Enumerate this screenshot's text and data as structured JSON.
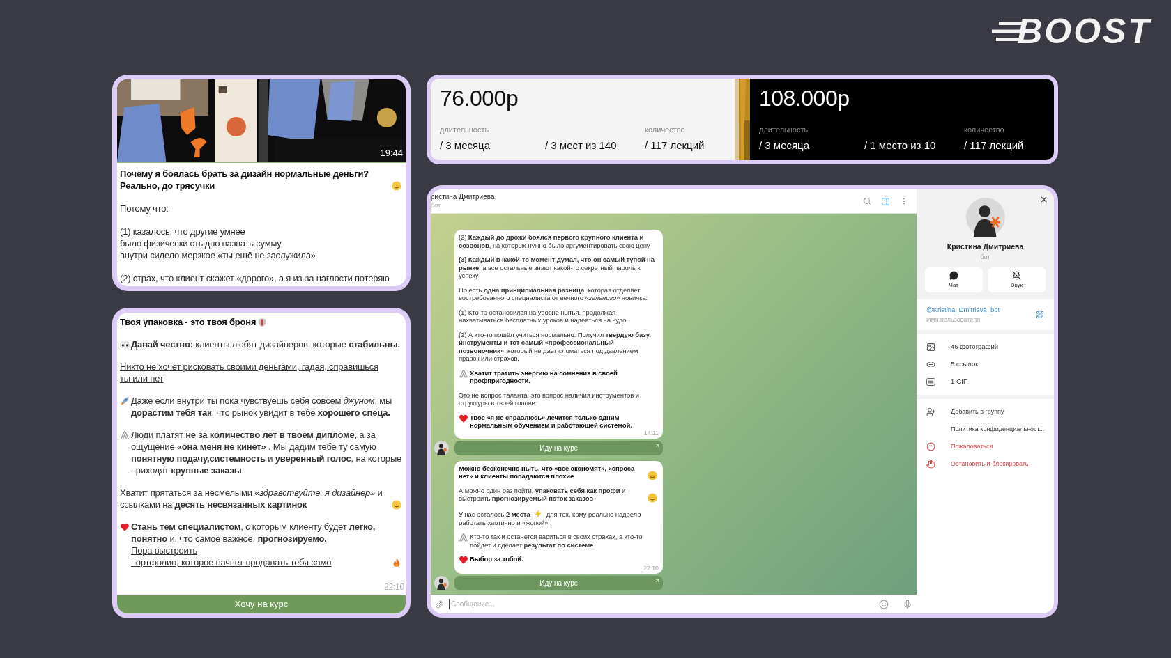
{
  "logo": {
    "text": "BOOST"
  },
  "post_preview": {
    "timestamp": "19:44",
    "paragraphs": [
      [
        {
          "kind": "text",
          "bold": true,
          "text": "Почему я боялась брать за дизайн нормальные деньги? Реально, до трясучки"
        },
        {
          "kind": "smile"
        }
      ],
      [
        {
          "kind": "text",
          "bold": false,
          "text": "Потому что:"
        }
      ],
      [
        {
          "kind": "text",
          "bold": false,
          "text": "(1) казалось, что другие умнее\nбыло физически стыдно назвать сумму\nвнутри сидело мерзкое «ты ещё не заслужила»"
        }
      ],
      [
        {
          "kind": "text",
          "bold": false,
          "text": "(2) страх, что клиент скажет «дорого», а я из-за наглости потеряю"
        }
      ]
    ]
  },
  "post_full": {
    "timestamp": "22:10",
    "button": "Хочу на курс",
    "paragraphs": [
      [
        {
          "kind": "text",
          "bold": true,
          "text": "Твоя упаковка - это твоя броня"
        },
        {
          "kind": "shield"
        }
      ],
      [
        {
          "kind": "eyes"
        },
        {
          "kind": "text",
          "bold": false,
          "text": "**Давай честно:** клиенты любят дизайнеров, которые **стабильны.**"
        }
      ],
      [
        {
          "kind": "link",
          "text": "Никто не хочет рисковать своими деньгами, гадая, справишься"
        },
        {
          "kind": "link",
          "text": "ты или нет"
        }
      ],
      [
        {
          "kind": "rocket"
        },
        {
          "kind": "text",
          "bold": false,
          "text": "Даже если внутри ты пока чувствуешь себя совсем *джуном*, мы **дорастим тебя так**, что рынок увидит в тебе **хорошего спеца.**"
        }
      ],
      [
        {
          "kind": "clip"
        },
        {
          "kind": "text",
          "bold": false,
          "text": "Люди платят **не за количество лет в твоем дипломе**, а за ощущение **«она меня не кинет»** . Мы дадим тебе ту самую **понятную подачу,системность** и **уверенный голос**, на которые приходят **крупные заказы**"
        }
      ],
      [
        {
          "kind": "text",
          "bold": false,
          "text": "Хватит прятаться за несмелыми *«здравствуйте, я дизайнер»* и ссылками на **десять несвязанных картинок**"
        },
        {
          "kind": "smile"
        }
      ],
      [
        {
          "kind": "heart"
        },
        {
          "kind": "text",
          "bold": false,
          "text": "**Стань тем специалистом**, с которым клиенту будет **легко, понятно** и, что самое важное, **прогнозируемо.**"
        },
        {
          "kind": "link",
          "text": "Пора выстроить"
        },
        {
          "kind": "link",
          "text": "портфолио, которое начнет продавать тебя само"
        },
        {
          "kind": "fire"
        }
      ]
    ]
  },
  "prices": [
    {
      "kind": "light",
      "price": "76.000р",
      "items": [
        {
          "label": "длительность",
          "value": "/ 3 месяца"
        },
        {
          "value": "/ 3 мест из 140"
        },
        {
          "label": "количество",
          "value": "/ 117 лекций"
        }
      ]
    },
    {
      "kind": "dark",
      "price": "108.000р",
      "items": [
        {
          "label": "длительность",
          "value": "/ 3 месяца"
        },
        {
          "value": "/ 1 место из 10"
        },
        {
          "label": "количество",
          "value": "/ 117 лекций"
        }
      ]
    }
  ],
  "chat": {
    "name": "ристина Дмитриева",
    "status": "бот",
    "placeholder": "Сообщение...",
    "messages": [
      {
        "time": "14:11",
        "button": "Иду на курс",
        "paragraphs": [
          [
            {
              "kind": "text",
              "bold": false,
              "text": "(2) **Каждый до дрожи боялся первого крупного клиента и созвонов**, на которых нужно было аргументировать свою цену"
            }
          ],
          [
            {
              "kind": "text",
              "bold": false,
              "text": "**(3) Каждый в какой-то момент думал, что он самый тупой на рынке**, а все остальные знают какой-то секретный пароль к успеху"
            }
          ],
          [
            {
              "kind": "text",
              "bold": false,
              "text": "Но есть **одна принципиальная разница**, которая отделяет востребованного специалиста от вечного *«зеленого»* новичка:"
            }
          ],
          [
            {
              "kind": "text",
              "bold": false,
              "text": "(1) Кто-то остановился на уровне нытья, продолжая нахватываться бесплатных уроков и надеяться на чудо"
            }
          ],
          [
            {
              "kind": "text",
              "bold": false,
              "text": "(2) А кто-то пошёл учиться нормально. Получил **твердую базу, инструменты и тот самый «профессиональный позвоночник»**, который не дает сломаться под давлением правок или страхов."
            }
          ],
          [
            {
              "kind": "clip"
            },
            {
              "kind": "text",
              "bold": true,
              "text": "Хватит тратить энергию на сомнения в своей профпригодности."
            }
          ],
          [
            {
              "kind": "text",
              "bold": false,
              "text": "Это не вопрос таланта, это вопрос наличия инструментов и структуры в твоей голове."
            }
          ],
          [
            {
              "kind": "heart"
            },
            {
              "kind": "text",
              "bold": true,
              "text": "Твоё «я не справлюсь» лечится только одним нормальным обучением и работающей системой."
            }
          ]
        ]
      },
      {
        "time": "22:10",
        "button": "Иду на курс",
        "paragraphs": [
          [
            {
              "kind": "text",
              "bold": true,
              "text": "Можно бесконечно ныть, что «все экономят», «спроса нет» и клиенты попадаются плохие"
            },
            {
              "kind": "smile"
            }
          ],
          [
            {
              "kind": "text",
              "bold": false,
              "text": "А можно один раз пойти, **упаковать себя как профи**  и выстроить **прогнозируемый поток заказов**"
            },
            {
              "kind": "smile"
            }
          ],
          [
            {
              "kind": "text",
              "bold": false,
              "text": "У нас осталось **2 места**"
            },
            {
              "kind": "bolt"
            },
            {
              "kind": "text",
              "bold": false,
              "text": "для тех, кому реально надоело работать хаотично и «жопой»."
            }
          ],
          [
            {
              "kind": "clip"
            },
            {
              "kind": "text",
              "bold": false,
              "text": "Кто-то так и останется вариться в своих страхах, а кто-то пойдет и сделает **результат по системе**"
            }
          ],
          [
            {
              "kind": "heart"
            },
            {
              "kind": "text",
              "bold": true,
              "text": "Выбор за тобой."
            }
          ]
        ]
      }
    ]
  },
  "profile": {
    "name": "Кристина Дмитриева",
    "status": "бот",
    "buttons": [
      {
        "kind": "chat",
        "label": "Чат"
      },
      {
        "kind": "mute",
        "label": "Звук"
      }
    ],
    "username": "@Kristina_Dmitrieva_bot",
    "username_label": "Имя пользователя",
    "media": [
      {
        "kind": "photos",
        "label": "46 фотографий"
      },
      {
        "kind": "links",
        "label": "5 ссылок"
      },
      {
        "kind": "gif",
        "label": "1 GIF"
      }
    ],
    "actions": [
      {
        "kind": "add",
        "label": "Добавить в группу",
        "danger": false
      },
      {
        "kind": "policy",
        "label": "Политика конфиденциальност...",
        "danger": false
      },
      {
        "kind": "report",
        "label": "Пожаловаться",
        "danger": true
      },
      {
        "kind": "block",
        "label": "Остановить и блокировать",
        "danger": true
      }
    ]
  }
}
